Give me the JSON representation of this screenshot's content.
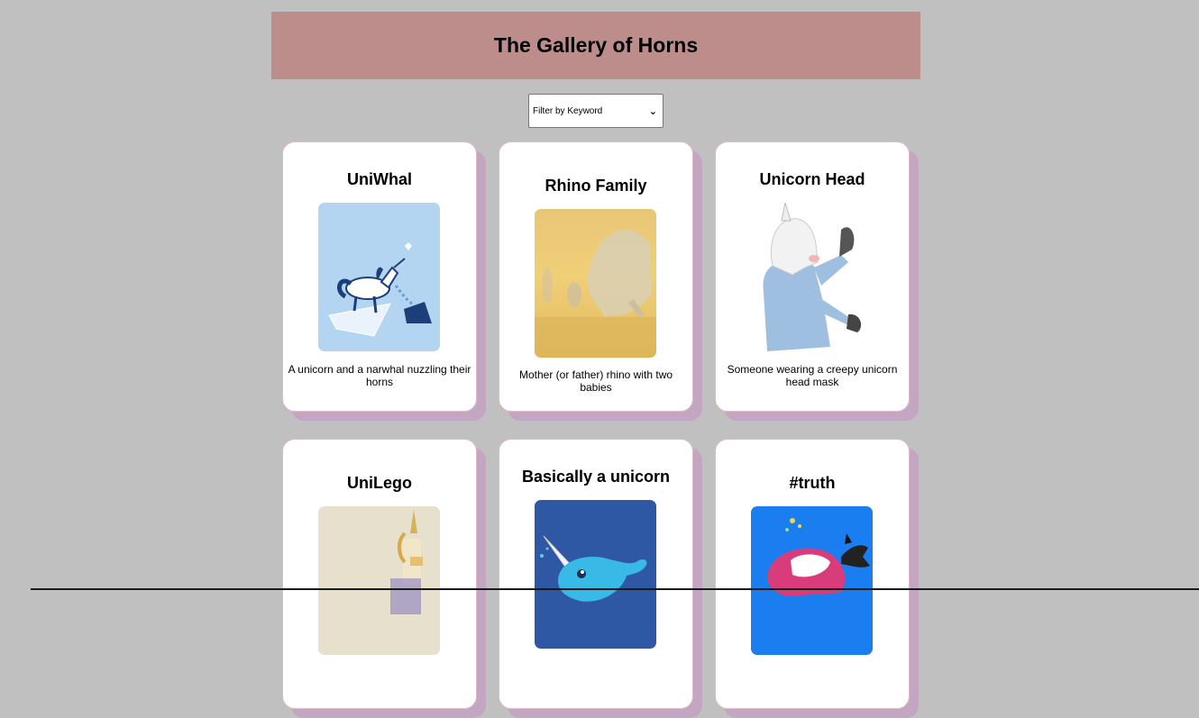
{
  "page": {
    "title": "The Gallery of Horns"
  },
  "filter": {
    "label": "Filter by Keyword"
  },
  "cards": [
    {
      "title": "UniWhal",
      "description": "A unicorn and a narwhal nuzzling their horns",
      "image": "unicorn-on-paper-boat"
    },
    {
      "title": "Rhino Family",
      "description": "Mother (or father) rhino with two babies",
      "image": "rhino-family-photo"
    },
    {
      "title": "Unicorn Head",
      "description": "Someone wearing a creepy unicorn head mask",
      "image": "unicorn-mask-person"
    },
    {
      "title": "UniLego",
      "description": "",
      "image": "lego-unicorn"
    },
    {
      "title": "Basically a unicorn",
      "description": "",
      "image": "cartoon-narwhal"
    },
    {
      "title": "#truth",
      "description": "",
      "image": "narwhal-illustration"
    }
  ],
  "colors": {
    "background": "#c0c0c0",
    "header": "#bc8d8b",
    "card_shadow": "#c2a6c2",
    "card_border": "#e3b8c8"
  }
}
